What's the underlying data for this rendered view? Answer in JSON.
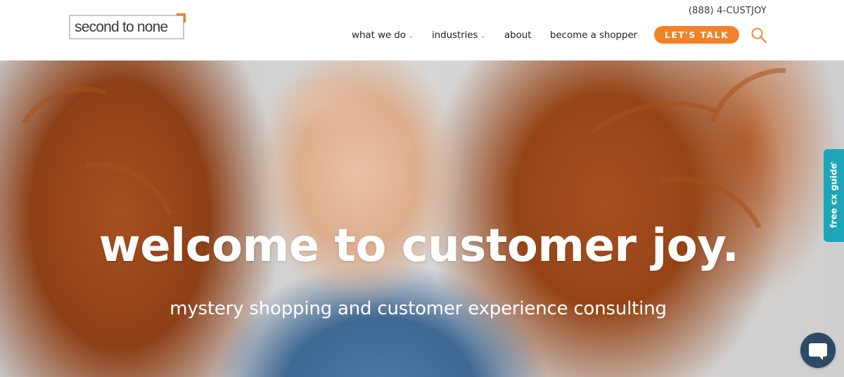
{
  "brand": {
    "logo_text": "second to none"
  },
  "header": {
    "phone": "(888) 4-CUSTJOY",
    "nav": [
      {
        "label": "what we do",
        "has_dropdown": true
      },
      {
        "label": "industries",
        "has_dropdown": true
      },
      {
        "label": "about",
        "has_dropdown": false
      },
      {
        "label": "become a shopper",
        "has_dropdown": false
      }
    ],
    "cta_label": "LET'S TALK",
    "search_icon": "search-icon"
  },
  "hero": {
    "title": "welcome to customer joy.",
    "subtitle": "mystery shopping and customer experience consulting"
  },
  "side_tab": {
    "label": "free cx guide",
    "icon": "chevron-left-icon"
  },
  "chat": {
    "icon": "chat-bubble-icon"
  },
  "colors": {
    "accent": "#f28127",
    "teal": "#1ea5b8",
    "chat": "#2c4a66"
  }
}
